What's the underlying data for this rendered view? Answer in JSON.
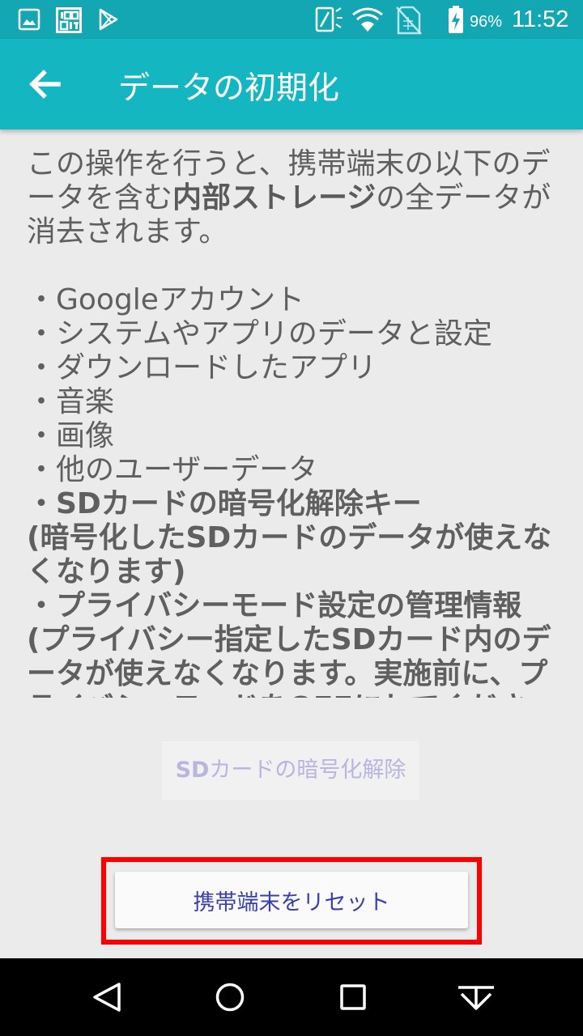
{
  "status_bar": {
    "battery_percent": "96%",
    "time": "11:52",
    "icons": [
      "image-icon",
      "iconit-icon",
      "play-store-icon",
      "sim-signal-icon",
      "wifi-icon",
      "no-sim-icon",
      "battery-charging-icon"
    ],
    "background": "#12a7b3"
  },
  "app_bar": {
    "title": "データの初期化",
    "background": "#14b6c1"
  },
  "content": {
    "intro_before": "この操作を行うと、携帯端末の以下のデータを含む",
    "intro_bold": "内部ストレージ",
    "intro_after": "の全データが消去されます。",
    "items": [
      "・Googleアカウント",
      "・システムやアプリのデータと設定",
      "・ダウンロードしたアプリ",
      "・音楽",
      "・画像",
      "・他のユーザーデータ"
    ],
    "sd_key_item": "・SDカードの暗号化解除キー",
    "sd_key_note": "(暗号化したSDカードのデータが使えなくなります)",
    "privacy_item": "・プライバシーモード設定の管理情報",
    "privacy_note": "(プライバシー指定したSDカード内のデータが使えなくなります。実施前に、プライバシーモードをOFFにしてください)"
  },
  "buttons": {
    "sd_decrypt_prefix": "SD",
    "sd_decrypt_rest": "カードの暗号化解除",
    "reset_label": "携帯端末をリセット",
    "highlight_color": "#ff0000",
    "accent_text": "#3a3fae"
  },
  "nav_bar": {
    "buttons": [
      "back-icon",
      "home-icon",
      "recents-icon",
      "hide-nav-icon"
    ]
  }
}
